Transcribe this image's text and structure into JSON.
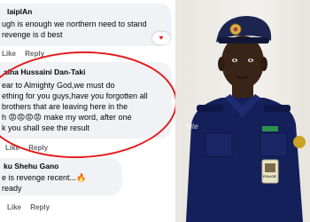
{
  "comments": [
    {
      "author": "laiplAn",
      "lines": [
        "ugh is enough we northern need to stand",
        "revenge is d best"
      ],
      "reaction_icon": "♥",
      "actions": [
        "Like",
        "Reply"
      ],
      "time": ""
    },
    {
      "author": "aina Hussaini Dan-Taki",
      "lines": [
        "ear to Almighty God,we must do",
        "ething for you guys,have you forgotten all",
        "brothers that are leaving here in the",
        "h 😡😡😡😡 make my word, after one",
        "k you shall see the result"
      ],
      "actions": [
        "Like",
        "Reply"
      ],
      "time": ""
    },
    {
      "author": "ku Shehu Gano",
      "lines": [
        "e is revenge recent...🔥",
        "ready"
      ],
      "actions": [
        "Like",
        "Reply"
      ]
    }
  ],
  "photo": {
    "watermark": "Vite",
    "badge_text": "POLICE",
    "colors": {
      "uniform": "#14205a",
      "beret": "#1b2550",
      "skin": "#3a2418",
      "background": "#eeebe6"
    }
  },
  "colors": {
    "circle": "#e41b1b",
    "bubble": "#f0f2f5",
    "meta": "#65676b"
  }
}
